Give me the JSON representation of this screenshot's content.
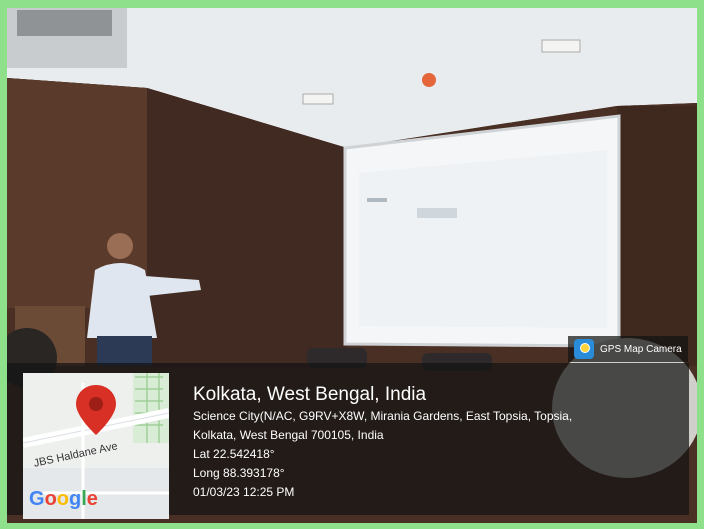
{
  "badge": {
    "icon": "gps-map-camera-icon",
    "label": "GPS Map Camera"
  },
  "map": {
    "road_label": "JBS Haldane Ave",
    "provider": "Google",
    "pin_color": "#d93025"
  },
  "location": {
    "title": "Kolkata, West Bengal, India",
    "address_line1": "Science City(N/AC, G9RV+X8W, Mirania Gardens, East Topsia, Topsia,",
    "address_line2": "Kolkata, West Bengal 700105, India",
    "lat": "Lat 22.542418°",
    "long": "Long 88.393178°",
    "datetime": "01/03/23 12:25 PM"
  },
  "colors": {
    "border": "#8fe08a",
    "overlay": "#141414"
  }
}
